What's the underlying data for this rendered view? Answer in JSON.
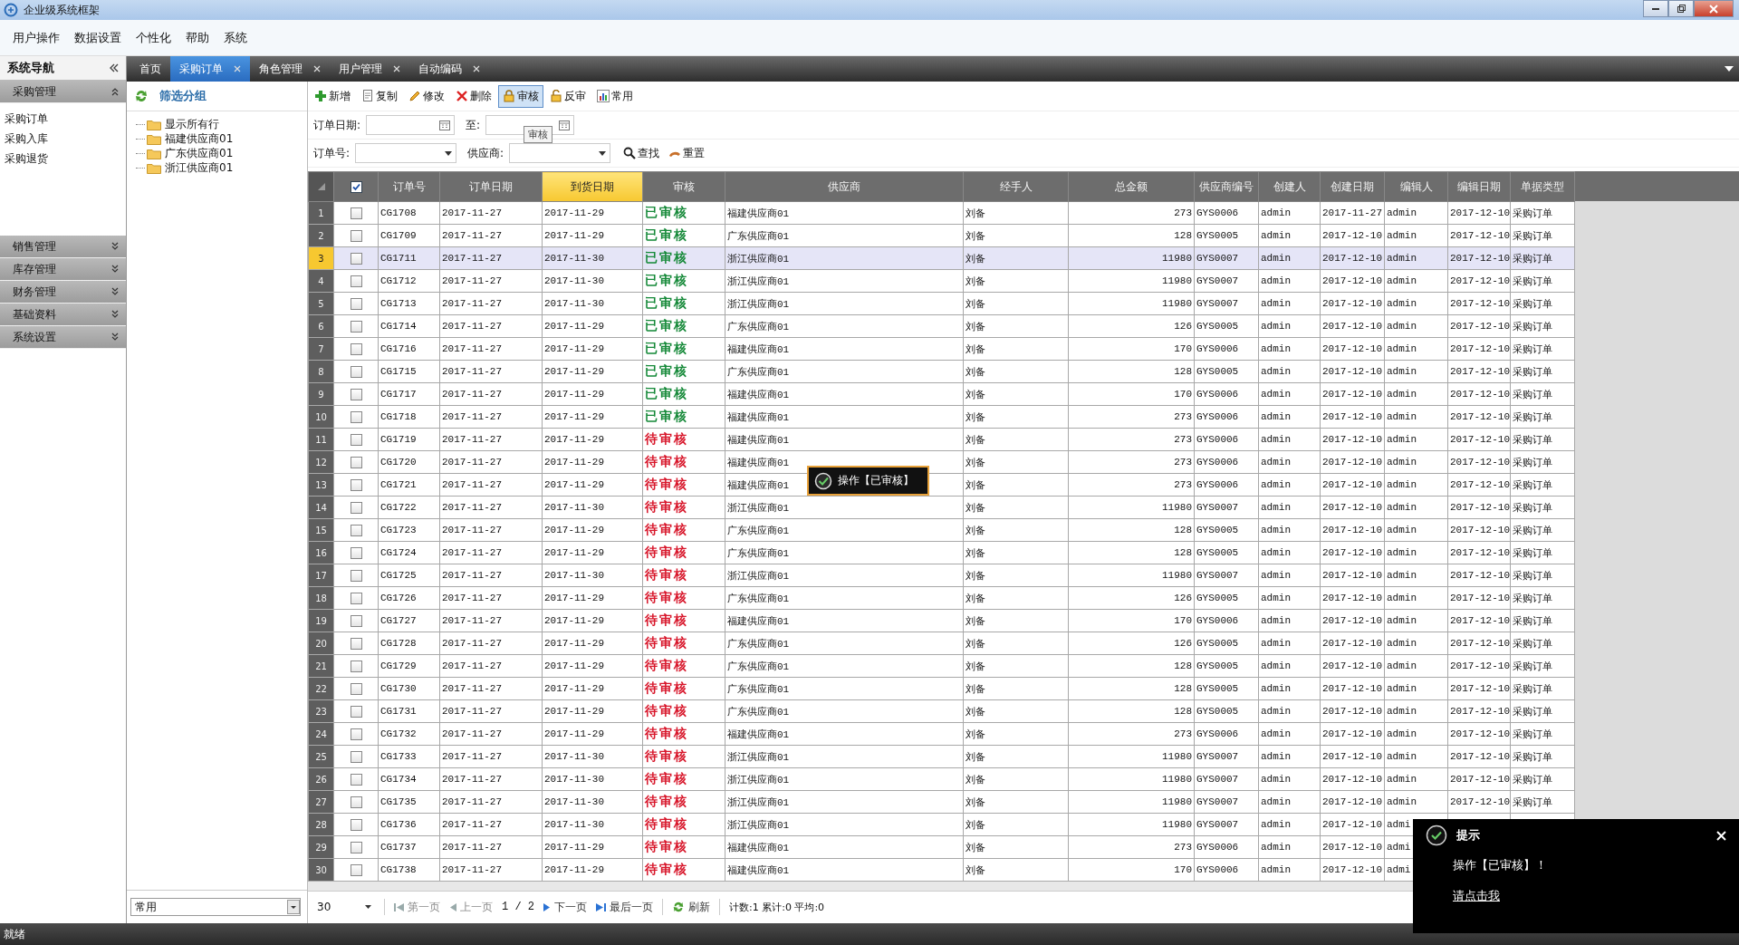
{
  "window": {
    "title": "企业级系统框架"
  },
  "menu": [
    "用户操作",
    "数据设置",
    "个性化",
    "帮助",
    "系统"
  ],
  "sidebar": {
    "title": "系统导航",
    "groups": [
      {
        "label": "采购管理",
        "expanded": true,
        "items": [
          "采购订单",
          "采购入库",
          "采购退货"
        ]
      },
      {
        "label": "销售管理",
        "expanded": false
      },
      {
        "label": "库存管理",
        "expanded": false
      },
      {
        "label": "财务管理",
        "expanded": false
      },
      {
        "label": "基础资料",
        "expanded": false
      },
      {
        "label": "系统设置",
        "expanded": false
      }
    ]
  },
  "tabs": [
    {
      "label": "首页",
      "selected": false,
      "closable": false
    },
    {
      "label": "采购订单",
      "selected": true,
      "closable": true
    },
    {
      "label": "角色管理",
      "selected": false,
      "closable": true
    },
    {
      "label": "用户管理",
      "selected": false,
      "closable": true
    },
    {
      "label": "自动编码",
      "selected": false,
      "closable": true
    }
  ],
  "filter_panel": {
    "title": "筛选分组",
    "tree": [
      "显示所有行",
      "福建供应商01",
      "广东供应商01",
      "浙江供应商01"
    ],
    "view_select": "常用"
  },
  "toolbar": [
    {
      "label": "新增",
      "kind": "add",
      "pressed": false
    },
    {
      "label": "复制",
      "kind": "copy",
      "pressed": false
    },
    {
      "label": "修改",
      "kind": "edit",
      "pressed": false
    },
    {
      "label": "删除",
      "kind": "delete",
      "pressed": false
    },
    {
      "label": "审核",
      "kind": "lock",
      "pressed": true
    },
    {
      "label": "反审",
      "kind": "unlock",
      "pressed": false
    },
    {
      "label": "常用",
      "kind": "chart",
      "pressed": false
    }
  ],
  "tooltip": "审核",
  "filters": [
    [
      {
        "label": "订单日期:",
        "kind": "date"
      },
      {
        "label": "至:",
        "kind": "date"
      }
    ],
    [
      {
        "label": "订单号:",
        "kind": "select"
      },
      {
        "label": "供应商:",
        "kind": "select"
      }
    ]
  ],
  "search_buttons": [
    {
      "label": "查找",
      "kind": "search"
    },
    {
      "label": "重置",
      "kind": "reset"
    }
  ],
  "grid": {
    "header_checked": true,
    "columns": [
      {
        "label": "订单号",
        "sorted": false,
        "kind": "text"
      },
      {
        "label": "订单日期",
        "sorted": false,
        "kind": "text"
      },
      {
        "label": "到货日期",
        "sorted": true,
        "kind": "text"
      },
      {
        "label": "审核",
        "sorted": false,
        "kind": "status"
      },
      {
        "label": "供应商",
        "sorted": false,
        "kind": "text"
      },
      {
        "label": "经手人",
        "sorted": false,
        "kind": "text"
      },
      {
        "label": "总金额",
        "sorted": false,
        "kind": "number"
      },
      {
        "label": "供应商编号",
        "sorted": false,
        "kind": "text"
      },
      {
        "label": "创建人",
        "sorted": false,
        "kind": "text"
      },
      {
        "label": "创建日期",
        "sorted": false,
        "kind": "text"
      },
      {
        "label": "编辑人",
        "sorted": false,
        "kind": "text"
      },
      {
        "label": "编辑日期",
        "sorted": false,
        "kind": "text"
      },
      {
        "label": "单据类型",
        "sorted": false,
        "kind": "text"
      }
    ],
    "rows": [
      {
        "number": "1",
        "checked": false,
        "selected": false,
        "approved": true,
        "cells": [
          "CG1708",
          "2017-11-27",
          "2017-11-29",
          "已审核",
          "福建供应商01",
          "刘备",
          "273",
          "GYS0006",
          "admin",
          "2017-11-27",
          "admin",
          "2017-12-10",
          "采购订单"
        ]
      },
      {
        "number": "2",
        "checked": false,
        "selected": false,
        "approved": true,
        "cells": [
          "CG1709",
          "2017-11-27",
          "2017-11-29",
          "已审核",
          "广东供应商01",
          "刘备",
          "128",
          "GYS0005",
          "admin",
          "2017-12-10",
          "admin",
          "2017-12-10",
          "采购订单"
        ]
      },
      {
        "number": "3",
        "checked": false,
        "selected": true,
        "approved": true,
        "cells": [
          "CG1711",
          "2017-11-27",
          "2017-11-30",
          "已审核",
          "浙江供应商01",
          "刘备",
          "11980",
          "GYS0007",
          "admin",
          "2017-12-10",
          "admin",
          "2017-12-10",
          "采购订单"
        ]
      },
      {
        "number": "4",
        "checked": false,
        "selected": false,
        "approved": true,
        "cells": [
          "CG1712",
          "2017-11-27",
          "2017-11-30",
          "已审核",
          "浙江供应商01",
          "刘备",
          "11980",
          "GYS0007",
          "admin",
          "2017-12-10",
          "admin",
          "2017-12-10",
          "采购订单"
        ]
      },
      {
        "number": "5",
        "checked": false,
        "selected": false,
        "approved": true,
        "cells": [
          "CG1713",
          "2017-11-27",
          "2017-11-30",
          "已审核",
          "浙江供应商01",
          "刘备",
          "11980",
          "GYS0007",
          "admin",
          "2017-12-10",
          "admin",
          "2017-12-10",
          "采购订单"
        ]
      },
      {
        "number": "6",
        "checked": false,
        "selected": false,
        "approved": true,
        "cells": [
          "CG1714",
          "2017-11-27",
          "2017-11-29",
          "已审核",
          "广东供应商01",
          "刘备",
          "126",
          "GYS0005",
          "admin",
          "2017-12-10",
          "admin",
          "2017-12-10",
          "采购订单"
        ]
      },
      {
        "number": "7",
        "checked": false,
        "selected": false,
        "approved": true,
        "cells": [
          "CG1716",
          "2017-11-27",
          "2017-11-29",
          "已审核",
          "福建供应商01",
          "刘备",
          "170",
          "GYS0006",
          "admin",
          "2017-12-10",
          "admin",
          "2017-12-10",
          "采购订单"
        ]
      },
      {
        "number": "8",
        "checked": false,
        "selected": false,
        "approved": true,
        "cells": [
          "CG1715",
          "2017-11-27",
          "2017-11-29",
          "已审核",
          "广东供应商01",
          "刘备",
          "128",
          "GYS0005",
          "admin",
          "2017-12-10",
          "admin",
          "2017-12-10",
          "采购订单"
        ]
      },
      {
        "number": "9",
        "checked": false,
        "selected": false,
        "approved": true,
        "cells": [
          "CG1717",
          "2017-11-27",
          "2017-11-29",
          "已审核",
          "福建供应商01",
          "刘备",
          "170",
          "GYS0006",
          "admin",
          "2017-12-10",
          "admin",
          "2017-12-10",
          "采购订单"
        ]
      },
      {
        "number": "10",
        "checked": false,
        "selected": false,
        "approved": true,
        "cells": [
          "CG1718",
          "2017-11-27",
          "2017-11-29",
          "已审核",
          "福建供应商01",
          "刘备",
          "273",
          "GYS0006",
          "admin",
          "2017-12-10",
          "admin",
          "2017-12-10",
          "采购订单"
        ]
      },
      {
        "number": "11",
        "checked": false,
        "selected": false,
        "approved": false,
        "cells": [
          "CG1719",
          "2017-11-27",
          "2017-11-29",
          "待审核",
          "福建供应商01",
          "刘备",
          "273",
          "GYS0006",
          "admin",
          "2017-12-10",
          "admin",
          "2017-12-10",
          "采购订单"
        ]
      },
      {
        "number": "12",
        "checked": false,
        "selected": false,
        "approved": false,
        "cells": [
          "CG1720",
          "2017-11-27",
          "2017-11-29",
          "待审核",
          "福建供应商01",
          "刘备",
          "273",
          "GYS0006",
          "admin",
          "2017-12-10",
          "admin",
          "2017-12-10",
          "采购订单"
        ]
      },
      {
        "number": "13",
        "checked": false,
        "selected": false,
        "approved": false,
        "cells": [
          "CG1721",
          "2017-11-27",
          "2017-11-29",
          "待审核",
          "福建供应商01",
          "刘备",
          "273",
          "GYS0006",
          "admin",
          "2017-12-10",
          "admin",
          "2017-12-10",
          "采购订单"
        ]
      },
      {
        "number": "14",
        "checked": false,
        "selected": false,
        "approved": false,
        "cells": [
          "CG1722",
          "2017-11-27",
          "2017-11-30",
          "待审核",
          "浙江供应商01",
          "刘备",
          "11980",
          "GYS0007",
          "admin",
          "2017-12-10",
          "admin",
          "2017-12-10",
          "采购订单"
        ]
      },
      {
        "number": "15",
        "checked": false,
        "selected": false,
        "approved": false,
        "cells": [
          "CG1723",
          "2017-11-27",
          "2017-11-29",
          "待审核",
          "广东供应商01",
          "刘备",
          "128",
          "GYS0005",
          "admin",
          "2017-12-10",
          "admin",
          "2017-12-10",
          "采购订单"
        ]
      },
      {
        "number": "16",
        "checked": false,
        "selected": false,
        "approved": false,
        "cells": [
          "CG1724",
          "2017-11-27",
          "2017-11-29",
          "待审核",
          "广东供应商01",
          "刘备",
          "128",
          "GYS0005",
          "admin",
          "2017-12-10",
          "admin",
          "2017-12-10",
          "采购订单"
        ]
      },
      {
        "number": "17",
        "checked": false,
        "selected": false,
        "approved": false,
        "cells": [
          "CG1725",
          "2017-11-27",
          "2017-11-30",
          "待审核",
          "浙江供应商01",
          "刘备",
          "11980",
          "GYS0007",
          "admin",
          "2017-12-10",
          "admin",
          "2017-12-10",
          "采购订单"
        ]
      },
      {
        "number": "18",
        "checked": false,
        "selected": false,
        "approved": false,
        "cells": [
          "CG1726",
          "2017-11-27",
          "2017-11-29",
          "待审核",
          "广东供应商01",
          "刘备",
          "126",
          "GYS0005",
          "admin",
          "2017-12-10",
          "admin",
          "2017-12-10",
          "采购订单"
        ]
      },
      {
        "number": "19",
        "checked": false,
        "selected": false,
        "approved": false,
        "cells": [
          "CG1727",
          "2017-11-27",
          "2017-11-29",
          "待审核",
          "福建供应商01",
          "刘备",
          "170",
          "GYS0006",
          "admin",
          "2017-12-10",
          "admin",
          "2017-12-10",
          "采购订单"
        ]
      },
      {
        "number": "20",
        "checked": false,
        "selected": false,
        "approved": false,
        "cells": [
          "CG1728",
          "2017-11-27",
          "2017-11-29",
          "待审核",
          "广东供应商01",
          "刘备",
          "126",
          "GYS0005",
          "admin",
          "2017-12-10",
          "admin",
          "2017-12-10",
          "采购订单"
        ]
      },
      {
        "number": "21",
        "checked": false,
        "selected": false,
        "approved": false,
        "cells": [
          "CG1729",
          "2017-11-27",
          "2017-11-29",
          "待审核",
          "广东供应商01",
          "刘备",
          "128",
          "GYS0005",
          "admin",
          "2017-12-10",
          "admin",
          "2017-12-10",
          "采购订单"
        ]
      },
      {
        "number": "22",
        "checked": false,
        "selected": false,
        "approved": false,
        "cells": [
          "CG1730",
          "2017-11-27",
          "2017-11-29",
          "待审核",
          "广东供应商01",
          "刘备",
          "128",
          "GYS0005",
          "admin",
          "2017-12-10",
          "admin",
          "2017-12-10",
          "采购订单"
        ]
      },
      {
        "number": "23",
        "checked": false,
        "selected": false,
        "approved": false,
        "cells": [
          "CG1731",
          "2017-11-27",
          "2017-11-29",
          "待审核",
          "广东供应商01",
          "刘备",
          "128",
          "GYS0005",
          "admin",
          "2017-12-10",
          "admin",
          "2017-12-10",
          "采购订单"
        ]
      },
      {
        "number": "24",
        "checked": false,
        "selected": false,
        "approved": false,
        "cells": [
          "CG1732",
          "2017-11-27",
          "2017-11-29",
          "待审核",
          "福建供应商01",
          "刘备",
          "273",
          "GYS0006",
          "admin",
          "2017-12-10",
          "admin",
          "2017-12-10",
          "采购订单"
        ]
      },
      {
        "number": "25",
        "checked": false,
        "selected": false,
        "approved": false,
        "cells": [
          "CG1733",
          "2017-11-27",
          "2017-11-30",
          "待审核",
          "浙江供应商01",
          "刘备",
          "11980",
          "GYS0007",
          "admin",
          "2017-12-10",
          "admin",
          "2017-12-10",
          "采购订单"
        ]
      },
      {
        "number": "26",
        "checked": false,
        "selected": false,
        "approved": false,
        "cells": [
          "CG1734",
          "2017-11-27",
          "2017-11-30",
          "待审核",
          "浙江供应商01",
          "刘备",
          "11980",
          "GYS0007",
          "admin",
          "2017-12-10",
          "admin",
          "2017-12-10",
          "采购订单"
        ]
      },
      {
        "number": "27",
        "checked": false,
        "selected": false,
        "approved": false,
        "cells": [
          "CG1735",
          "2017-11-27",
          "2017-11-30",
          "待审核",
          "浙江供应商01",
          "刘备",
          "11980",
          "GYS0007",
          "admin",
          "2017-12-10",
          "admin",
          "2017-12-10",
          "采购订单"
        ]
      },
      {
        "number": "28",
        "checked": false,
        "selected": false,
        "approved": false,
        "cells": [
          "CG1736",
          "2017-11-27",
          "2017-11-30",
          "待审核",
          "浙江供应商01",
          "刘备",
          "11980",
          "GYS0007",
          "admin",
          "2017-12-10",
          "admi"
        ]
      },
      {
        "number": "29",
        "checked": false,
        "selected": false,
        "approved": false,
        "cells": [
          "CG1737",
          "2017-11-27",
          "2017-11-29",
          "待审核",
          "福建供应商01",
          "刘备",
          "273",
          "GYS0006",
          "admin",
          "2017-12-10",
          "admi"
        ]
      },
      {
        "number": "30",
        "checked": false,
        "selected": false,
        "approved": false,
        "cells": [
          "CG1738",
          "2017-11-27",
          "2017-11-29",
          "待审核",
          "福建供应商01",
          "刘备",
          "170",
          "GYS0006",
          "admin",
          "2017-12-10",
          "admi"
        ]
      }
    ]
  },
  "pager": {
    "page_size": "30",
    "first": "第一页",
    "prev": "上一页",
    "page": "1 / 2",
    "next": "下一页",
    "last": "最后一页",
    "refresh": "刷新",
    "summary": "计数:1 累计:0 平均:0"
  },
  "status_bar": "就绪",
  "center_toast": "操作【已审核】",
  "notification": {
    "title": "提示",
    "message": "操作【已审核】！",
    "link": "请点击我"
  }
}
